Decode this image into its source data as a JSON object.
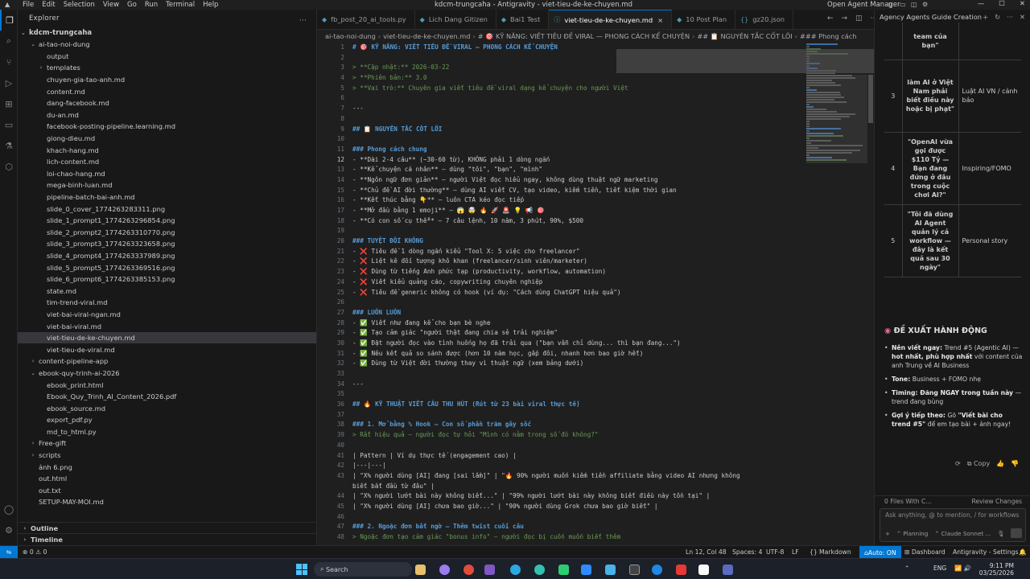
{
  "titlebar": {
    "menu": [
      "File",
      "Edit",
      "Selection",
      "View",
      "Go",
      "Run",
      "Terminal",
      "Help"
    ],
    "window_title": "kdcm-trungcaha - Antigravity - viet-tieu-de-ke-chuyen.md",
    "agent_manager": "Open Agent Manager"
  },
  "sidebar": {
    "header": "Explorer",
    "root": "kdcm-trungcaha",
    "items": [
      {
        "depth": 1,
        "chev": "⌄",
        "name": "ai-tao-noi-dung"
      },
      {
        "depth": 2,
        "chev": "",
        "name": "output"
      },
      {
        "depth": 2,
        "chev": "›",
        "name": "templates"
      },
      {
        "depth": 2,
        "chev": "",
        "name": "chuyen-gia-tao-anh.md"
      },
      {
        "depth": 2,
        "chev": "",
        "name": "content.md"
      },
      {
        "depth": 2,
        "chev": "",
        "name": "dang-facebook.md"
      },
      {
        "depth": 2,
        "chev": "",
        "name": "du-an.md"
      },
      {
        "depth": 2,
        "chev": "",
        "name": "facebook-posting-pipeline.learning.md"
      },
      {
        "depth": 2,
        "chev": "",
        "name": "giong-dieu.md"
      },
      {
        "depth": 2,
        "chev": "",
        "name": "khach-hang.md"
      },
      {
        "depth": 2,
        "chev": "",
        "name": "lich-content.md"
      },
      {
        "depth": 2,
        "chev": "",
        "name": "loi-chao-hang.md"
      },
      {
        "depth": 2,
        "chev": "",
        "name": "mega-binh-luan.md"
      },
      {
        "depth": 2,
        "chev": "",
        "name": "pipeline-batch-bai-anh.md"
      },
      {
        "depth": 2,
        "chev": "",
        "name": "slide_0_cover_1774263283311.png"
      },
      {
        "depth": 2,
        "chev": "",
        "name": "slide_1_prompt1_1774263296854.png"
      },
      {
        "depth": 2,
        "chev": "",
        "name": "slide_2_prompt2_1774263310770.png"
      },
      {
        "depth": 2,
        "chev": "",
        "name": "slide_3_prompt3_1774263323658.png"
      },
      {
        "depth": 2,
        "chev": "",
        "name": "slide_4_prompt4_1774263337989.png"
      },
      {
        "depth": 2,
        "chev": "",
        "name": "slide_5_prompt5_1774263369516.png"
      },
      {
        "depth": 2,
        "chev": "",
        "name": "slide_6_prompt6_1774263385153.png"
      },
      {
        "depth": 2,
        "chev": "",
        "name": "state.md"
      },
      {
        "depth": 2,
        "chev": "",
        "name": "tim-trend-viral.md"
      },
      {
        "depth": 2,
        "chev": "",
        "name": "viet-bai-viral-ngan.md"
      },
      {
        "depth": 2,
        "chev": "",
        "name": "viet-bai-viral.md"
      },
      {
        "depth": 2,
        "chev": "",
        "name": "viet-tieu-de-ke-chuyen.md",
        "selected": true
      },
      {
        "depth": 2,
        "chev": "",
        "name": "viet-tieu-de-viral.md"
      },
      {
        "depth": 1,
        "chev": "›",
        "name": "content-pipeline-app"
      },
      {
        "depth": 1,
        "chev": "⌄",
        "name": "ebook-quy-trinh-ai-2026"
      },
      {
        "depth": 2,
        "chev": "",
        "name": "ebook_print.html"
      },
      {
        "depth": 2,
        "chev": "",
        "name": "Ebook_Quy_Trinh_AI_Content_2026.pdf"
      },
      {
        "depth": 2,
        "chev": "",
        "name": "ebook_source.md"
      },
      {
        "depth": 2,
        "chev": "",
        "name": "export_pdf.py"
      },
      {
        "depth": 2,
        "chev": "",
        "name": "md_to_html.py"
      },
      {
        "depth": 1,
        "chev": "›",
        "name": "Free-gift"
      },
      {
        "depth": 1,
        "chev": "›",
        "name": "scripts"
      },
      {
        "depth": 1,
        "chev": "",
        "name": "ảnh 6.png"
      },
      {
        "depth": 1,
        "chev": "",
        "name": "out.html"
      },
      {
        "depth": 1,
        "chev": "",
        "name": "out.txt"
      },
      {
        "depth": 1,
        "chev": "",
        "name": "SETUP-MAY-MOI.md"
      }
    ],
    "outline": "Outline",
    "timeline": "Timeline"
  },
  "tabs": [
    {
      "label": "fb_post_20_ai_tools.py",
      "icon": "◆"
    },
    {
      "label": "Lich Dang Gitizen",
      "icon": "◆"
    },
    {
      "label": "Bai1 Test",
      "icon": "◆"
    },
    {
      "label": "viet-tieu-de-ke-chuyen.md",
      "icon": "ⓘ",
      "active": true,
      "close": "×"
    },
    {
      "label": "10 Post Plan",
      "icon": "◆"
    },
    {
      "label": "gz20.json",
      "icon": "{}"
    }
  ],
  "breadcrumb": [
    "ai-tao-noi-dung",
    "viet-tieu-de-ke-chuyen.md",
    "# 🎯 KỸ NĂNG: VIẾT TIÊU ĐỀ VIRAL — PHONG CÁCH KỂ CHUYỆN",
    "## 📋 NGUYÊN TẮC CỐT LÕI",
    "### Phong cách"
  ],
  "editor": {
    "current_line": 12,
    "lines": [
      {
        "n": 1,
        "k": "h",
        "t": "# 🎯 KỸ NĂNG: VIẾT TIÊU ĐỀ VIRAL — PHONG CÁCH KỂ CHUYỆN"
      },
      {
        "n": 2,
        "k": "t",
        "t": ""
      },
      {
        "n": 3,
        "k": "q",
        "t": "> **Cập nhật:** 2026-03-22"
      },
      {
        "n": 4,
        "k": "q",
        "t": "> **Phiên bản:** 3.0"
      },
      {
        "n": 5,
        "k": "q",
        "t": "> **Vai trò:** Chuyên gia viết tiêu đề viral dạng kể chuyện cho người Việt"
      },
      {
        "n": 6,
        "k": "t",
        "t": ""
      },
      {
        "n": 7,
        "k": "t",
        "t": "---"
      },
      {
        "n": 8,
        "k": "t",
        "t": ""
      },
      {
        "n": 9,
        "k": "h",
        "t": "## 📋 NGUYÊN TẮC CỐT LÕI"
      },
      {
        "n": 10,
        "k": "t",
        "t": ""
      },
      {
        "n": 11,
        "k": "h",
        "t": "### Phong cách chung"
      },
      {
        "n": 12,
        "k": "l",
        "t": "- **Dài 2-4 câu** (~30-60 từ), KHÔNG phải 1 dòng ngắn"
      },
      {
        "n": 13,
        "k": "l",
        "t": "- **Kể chuyện cá nhân** — dùng \"tôi\", \"bạn\", \"mình\""
      },
      {
        "n": 14,
        "k": "l",
        "t": "- **Ngôn ngữ đơn giản** — người Việt đọc hiểu ngay, không dùng thuật ngữ marketing"
      },
      {
        "n": 15,
        "k": "l",
        "t": "- **Chủ đề AI đời thường** — dùng AI viết CV, tạo video, kiếm tiền, tiết kiệm thời gian"
      },
      {
        "n": 16,
        "k": "l",
        "t": "- **Kết thúc bằng 👇** — luôn CTA kéo đọc tiếp"
      },
      {
        "n": 17,
        "k": "l",
        "t": "- **Mở đầu bằng 1 emoji** — 😱 🤯 🔥 🚀 🚨 💡 📢 🎯"
      },
      {
        "n": 18,
        "k": "l",
        "t": "- **Có con số cụ thể** — 7 câu lệnh, 10 năm, 3 phút, 90%, $500"
      },
      {
        "n": 19,
        "k": "t",
        "t": ""
      },
      {
        "n": 20,
        "k": "h",
        "t": "### TUYỆT ĐỐI KHÔNG"
      },
      {
        "n": 21,
        "k": "l",
        "t": "- ❌ Tiêu đề 1 dòng ngắn kiểu \"Tool X: 5 việc cho freelancer\""
      },
      {
        "n": 22,
        "k": "l",
        "t": "- ❌ Liệt kê đối tượng khô khan (freelancer/sinh viên/marketer)"
      },
      {
        "n": 23,
        "k": "l",
        "t": "- ❌ Dùng từ tiếng Anh phức tạp (productivity, workflow, automation)"
      },
      {
        "n": 24,
        "k": "l",
        "t": "- ❌ Viết kiểu quảng cáo, copywriting chuyên nghiệp"
      },
      {
        "n": 25,
        "k": "l",
        "t": "- ❌ Tiêu đề generic không có hook (ví dụ: \"Cách dùng ChatGPT hiệu quả\")"
      },
      {
        "n": 26,
        "k": "t",
        "t": ""
      },
      {
        "n": 27,
        "k": "h",
        "t": "### LUÔN LUÔN"
      },
      {
        "n": 28,
        "k": "l",
        "t": "- ✅ Viết như đang kể cho bạn bè nghe"
      },
      {
        "n": 29,
        "k": "l",
        "t": "- ✅ Tạo cảm giác \"người thật đang chia sẻ trải nghiệm\""
      },
      {
        "n": 30,
        "k": "l",
        "t": "- ✅ Đặt người đọc vào tình huống họ đã trải qua (\"bạn vẫn chỉ dùng... thì bạn đang...\")"
      },
      {
        "n": 31,
        "k": "l",
        "t": "- ✅ Nêu kết quả so sánh được (hơn 10 năm học, gấp đôi, nhanh hơn bao giờ hết)"
      },
      {
        "n": 32,
        "k": "l",
        "t": "- ✅ Dùng từ Việt đời thường thay vì thuật ngữ (xem bảng dưới)"
      },
      {
        "n": 33,
        "k": "t",
        "t": ""
      },
      {
        "n": 34,
        "k": "t",
        "t": "---"
      },
      {
        "n": 35,
        "k": "t",
        "t": ""
      },
      {
        "n": 36,
        "k": "h",
        "t": "## 🔥 KỸ THUẬT VIẾT CÂU THU HÚT (Rút từ 23 bài viral thực tế)"
      },
      {
        "n": 37,
        "k": "t",
        "t": ""
      },
      {
        "n": 38,
        "k": "h",
        "t": "### 1. Mở bằng % Hook — Con số phần trăm gây sốc"
      },
      {
        "n": 39,
        "k": "q",
        "t": "> Rất hiệu quả — người đọc tự hỏi \"Mình có nằm trong số đó không?\""
      },
      {
        "n": 40,
        "k": "t",
        "t": ""
      },
      {
        "n": 41,
        "k": "t",
        "t": "| Pattern | Ví dụ thực tế (engagement cao) |"
      },
      {
        "n": 42,
        "k": "t",
        "t": "|---|---|"
      },
      {
        "n": 43,
        "k": "t",
        "t": "| \"X% người dùng [AI] đang [sai lầm]\" | \"🔥 90% người muốn kiếm tiền affiliate bằng video AI nhưng không"
      },
      {
        "n": "",
        "k": "t",
        "t": "biết bắt đầu từ đâu\" |"
      },
      {
        "n": 44,
        "k": "t",
        "t": "| \"X% người lướt bài này không biết...\" | \"99% người lướt bài này không biết điều này tồn tại\" |"
      },
      {
        "n": 45,
        "k": "t",
        "t": "| \"X% người dùng [AI] chưa bao giờ...\" | \"90% người dùng Grok chưa bao giờ biết\" |"
      },
      {
        "n": 46,
        "k": "t",
        "t": ""
      },
      {
        "n": 47,
        "k": "h",
        "t": "### 2. Ngoặc đơn bất ngờ — Thêm twist cuối câu"
      },
      {
        "n": 48,
        "k": "q",
        "t": "> Ngoặc đơn tạo cảm giác \"bonus info\" — người đọc bị cuốn muốn biết thêm"
      }
    ]
  },
  "rpanel": {
    "title": "Agency Agents Guide Creation",
    "table": [
      {
        "num": "",
        "hook": "team của bạn\"",
        "type": ""
      },
      {
        "num": "3",
        "hook": "làm AI ở Việt Nam phải biết điều này hoặc bị phạt\"",
        "type": "Luật AI VN / cảnh báo"
      },
      {
        "num": "4",
        "hook": "\"OpenAI vừa gọi được $110 Tỷ — Bạn đang đứng ở đâu trong cuộc chơi AI?\"",
        "type": "Inspiring/FOMO"
      },
      {
        "num": "5",
        "hook": "\"Tôi đã dùng AI Agent quản lý cả workflow — đây là kết quả sau 30 ngày\"",
        "type": "Personal story"
      }
    ],
    "suggest_title": "ĐỀ XUẤT HÀNH ĐỘNG",
    "suggest": [
      {
        "b": "Nên viết ngay:",
        "t": " Trend #5 (Agentic AI) — ",
        "b2": "hot nhất, phù hợp nhất",
        "t2": " với content của anh Trung về AI Business"
      },
      {
        "b": "Tone:",
        "t": " Business + FOMO nhẹ",
        "b2": "",
        "t2": ""
      },
      {
        "b": "Timing: Đăng NGAY trong tuần này",
        "t": " — trend đang bùng",
        "b2": "",
        "t2": ""
      },
      {
        "b": "Gợi ý tiếp theo:",
        "t": " Gõ ",
        "b2": "\"Viết bài cho trend #5\"",
        "t2": " để em tạo bài + ảnh ngay!"
      }
    ],
    "copy": "Copy",
    "files_changed": "0 Files With C...",
    "review_changes": "Review Changes",
    "chat_placeholder": "Ask anything, @ to mention, / for workflows",
    "mode": "Planning",
    "model": "Claude Sonnet ..."
  },
  "status": {
    "errors": "⊗ 0  ⚠ 0",
    "position": "Ln 12, Col 48",
    "spaces": "Spaces: 4",
    "encoding": "UTF-8",
    "eol": "LF",
    "language": "Markdown",
    "auto": "Auto: ON",
    "dashboard": "Dashboard",
    "settings": "Antigravity - Settings"
  },
  "taskbar": {
    "search": "Search",
    "lang": "ENG",
    "time": "9:11 PM",
    "date": "03/25/2026"
  }
}
